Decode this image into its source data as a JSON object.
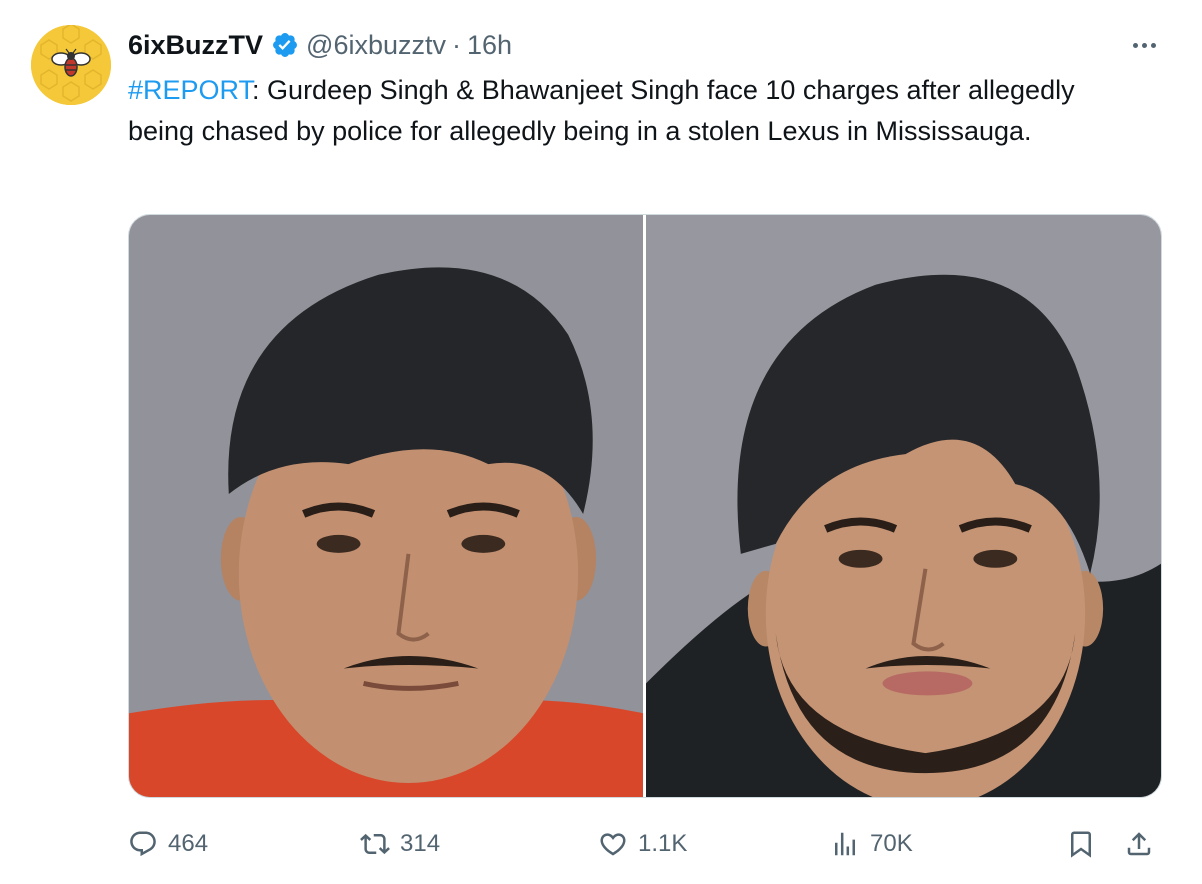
{
  "author": {
    "display_name": "6ixBuzzTV",
    "handle": "@6ixbuzztv",
    "separator": "·",
    "time": "16h"
  },
  "tweet": {
    "hashtag": "#REPORT",
    "body": ": Gurdeep Singh & Bhawanjeet Singh face 10 charges after allegedly being chased by police for allegedly being in a stolen Lexus in Mississauga."
  },
  "actions": {
    "replies": "464",
    "reposts": "314",
    "likes": "1.1K",
    "views": "70K"
  },
  "icons": {
    "verified": "verified-badge-icon",
    "more": "more-icon",
    "reply": "reply-icon",
    "repost": "repost-icon",
    "like": "heart-icon",
    "views": "views-icon",
    "bookmark": "bookmark-icon",
    "share": "share-icon"
  },
  "colors": {
    "accent": "#1d9bf0",
    "text": "#0f1419",
    "secondary": "#536471",
    "avatar_bg": "#f4c838"
  }
}
